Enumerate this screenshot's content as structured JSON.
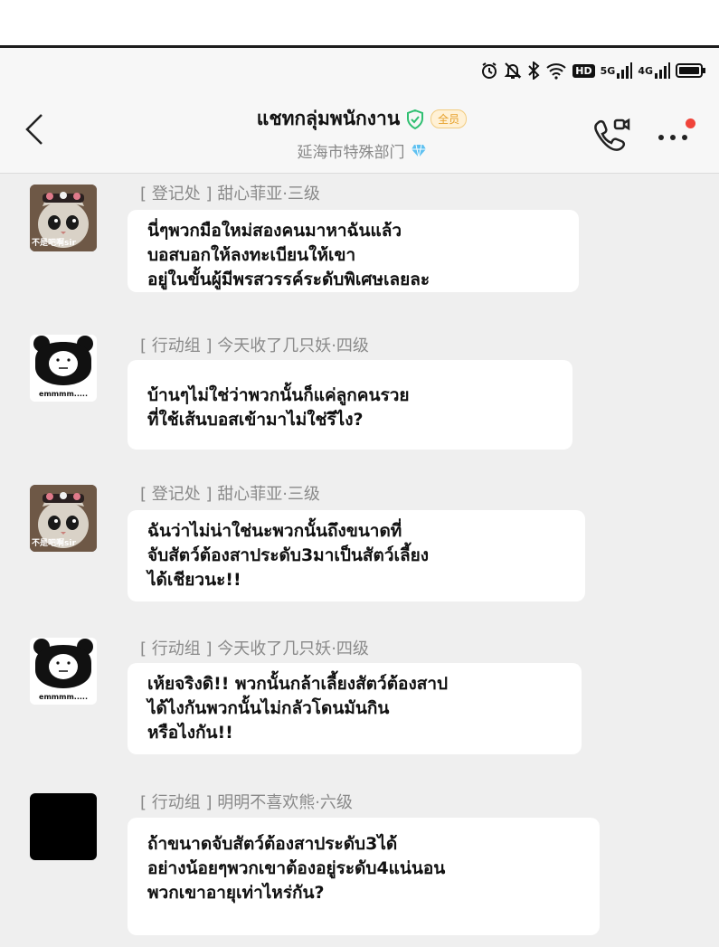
{
  "nav": {
    "title": "แชทกลุ่มพนักงาน",
    "badge": "全员",
    "subtitle": "延海市特殊部门"
  },
  "status_bar": {
    "icons": [
      "alarm-icon",
      "mute-bell-icon",
      "bluetooth-icon",
      "wifi-icon",
      "hd-icon",
      "signal-5g-icon",
      "signal-4g-icon",
      "battery-icon"
    ],
    "hd_label": "HD",
    "net1_label": "5G",
    "net2_label": "4G"
  },
  "colors": {
    "chat_background": "#efefef",
    "bubble": "#ffffff",
    "verified": "#2fbf71",
    "badge": "#e6a02a",
    "notification_dot": "#f0443a"
  },
  "messages": [
    {
      "sender": "[ 登记处 ] 甜心菲亚·三级",
      "avatar": "cat-avatar",
      "avatar_caption": "不是吧啊sir",
      "lines": [
        "นี่ๆพวกมือใหม่สองคนมาหาฉันแล้ว",
        "บอสบอกให้ลงทะเบียนให้เขา",
        "อยู่ในขั้นผู้มีพรสวรรค์ระดับพิเศษเลยละ"
      ]
    },
    {
      "sender": "[ 行动组 ] 今天收了几只妖·四级",
      "avatar": "panda-avatar",
      "avatar_caption": "emmmm.....",
      "lines": [
        "บ้านๆไม่ใช่ว่าพวกนั้นก็แค่ลูกคนรวย",
        "ที่ใช้เส้นบอสเข้ามาไม่ใช่รึไง?"
      ]
    },
    {
      "sender": "[ 登记处 ] 甜心菲亚·三级",
      "avatar": "cat-avatar",
      "avatar_caption": "不是吧啊sir",
      "lines": [
        "ฉันว่าไม่น่าใช่นะพวกนั้นถึงขนาดที่",
        "จับสัตว์ต้องสาประดับ3มาเป็นสัตว์เลี้ยง",
        "ได้เชียวนะ!!"
      ]
    },
    {
      "sender": "[ 行动组 ] 今天收了几只妖·四级",
      "avatar": "panda-avatar",
      "avatar_caption": "emmmm.....",
      "lines": [
        "เห้ยจริงดิ!! พวกนั้นกล้าเลี้ยงสัตว์ต้องสาป",
        "ได้ไงกันพวกนั้นไม่กลัวโดนมันกิน",
        "หรือไงกัน!!"
      ]
    },
    {
      "sender": "[ 行动组 ] 明明不喜欢熊·六级",
      "avatar": "black-avatar",
      "avatar_caption": "",
      "lines": [
        "ถ้าขนาดจับสัตว์ต้องสาประดับ3ได้",
        "อย่างน้อยๆพวกเขาต้องอยู่ระดับ4แน่นอน",
        "พวกเขาอายุเท่าไหร่กัน?"
      ]
    }
  ]
}
